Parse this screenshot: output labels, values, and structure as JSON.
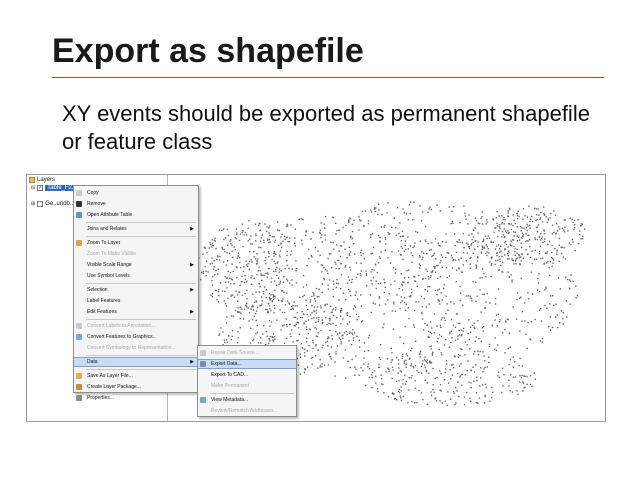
{
  "slide": {
    "title": "Export as shapefile",
    "body": "XY events should be exported as permanent shapefile or feature class"
  },
  "toc": {
    "root_label": "Layers",
    "layer_label": "Table_F2...",
    "second_label": "Ge..undb..."
  },
  "context_menu": {
    "items": [
      {
        "label": "Copy",
        "disabled": false,
        "arrow": false,
        "icon_color": "#c9c9c9"
      },
      {
        "label": "Remove",
        "disabled": false,
        "arrow": false,
        "icon_color": "#333333"
      },
      {
        "label": "Open Attribute Table",
        "disabled": false,
        "arrow": false,
        "icon_color": "#6f8fbf"
      },
      {
        "label": "Joins and Relates",
        "disabled": false,
        "arrow": true,
        "icon_color": ""
      },
      {
        "label": "Zoom To Layer",
        "disabled": false,
        "arrow": false,
        "icon_color": "#d8a640"
      },
      {
        "label": "Zoom To Make Visible",
        "disabled": true,
        "arrow": false,
        "icon_color": ""
      },
      {
        "label": "Visible Scale Range",
        "disabled": false,
        "arrow": true,
        "icon_color": ""
      },
      {
        "label": "Use Symbol Levels",
        "disabled": false,
        "arrow": false,
        "icon_color": ""
      },
      {
        "label": "Selection",
        "disabled": false,
        "arrow": true,
        "icon_color": ""
      },
      {
        "label": "Label Features",
        "disabled": false,
        "arrow": false,
        "icon_color": ""
      },
      {
        "label": "Edit Features",
        "disabled": false,
        "arrow": true,
        "icon_color": ""
      },
      {
        "label": "Convert Labels to Annotation...",
        "disabled": true,
        "arrow": false,
        "icon_color": "#c9c9c9"
      },
      {
        "label": "Convert Features to Graphics...",
        "disabled": false,
        "arrow": false,
        "icon_color": "#7fa7d4"
      },
      {
        "label": "Convert Symbology to Representation...",
        "disabled": true,
        "arrow": false,
        "icon_color": ""
      },
      {
        "label": "Data",
        "disabled": false,
        "arrow": true,
        "icon_color": "",
        "highlight": true
      },
      {
        "label": "Save As Layer File...",
        "disabled": false,
        "arrow": false,
        "icon_color": "#d9b347"
      },
      {
        "label": "Create Layer Package...",
        "disabled": false,
        "arrow": false,
        "icon_color": "#c98b3a"
      },
      {
        "label": "Properties...",
        "disabled": false,
        "arrow": false,
        "icon_color": "#8c8c8c"
      }
    ]
  },
  "data_submenu": {
    "items": [
      {
        "label": "Repair Data Source...",
        "disabled": true,
        "icon_color": "#c9c9c9"
      },
      {
        "label": "Export Data...",
        "disabled": false,
        "icon_color": "#6c8fc2",
        "highlight": true
      },
      {
        "label": "Export To CAD...",
        "disabled": false,
        "icon_color": ""
      },
      {
        "label": "Make Permanent",
        "disabled": true,
        "icon_color": ""
      },
      {
        "label": "View Metadata...",
        "disabled": false,
        "icon_color": "#7fa2cf"
      },
      {
        "label": "Review/Rematch Addresses...",
        "disabled": true,
        "icon_color": ""
      }
    ]
  },
  "colors": {
    "title_rule": "#8b5a3c",
    "menu_highlight": "#c9dcf5",
    "map_points": "#6a6a6a"
  }
}
